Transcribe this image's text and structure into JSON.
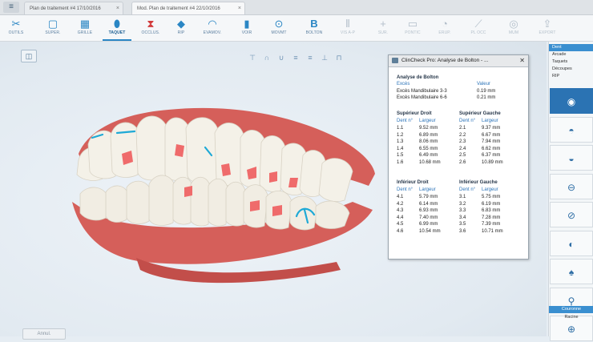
{
  "tabs": [
    {
      "label": "Plan de traitement #4 17/10/2016"
    },
    {
      "label": "Mod. Plan de traitement #4 22/10/2016"
    }
  ],
  "toolbar": [
    {
      "label": "OUTILS",
      "icon": "tools-icon",
      "glyph": "✂",
      "enabled": true
    },
    {
      "label": "SUPER.",
      "icon": "superimpose-icon",
      "glyph": "▢",
      "enabled": true
    },
    {
      "label": "GRILLE",
      "icon": "grid-icon",
      "glyph": "▦",
      "enabled": true
    },
    {
      "label": "TAQUET",
      "icon": "attachment-icon",
      "glyph": "⬮",
      "enabled": true,
      "active": true
    },
    {
      "label": "OCCLUS.",
      "icon": "occlusion-icon",
      "glyph": "⧗",
      "enabled": true
    },
    {
      "label": "RIP",
      "icon": "ipr-icon",
      "glyph": "◆",
      "enabled": true
    },
    {
      "label": "EVAMOV.",
      "icon": "evaluation-icon",
      "glyph": "◠",
      "enabled": true
    },
    {
      "label": "VOIR",
      "icon": "view-icon",
      "glyph": "▮",
      "enabled": true
    },
    {
      "label": "MOVMT",
      "icon": "movement-icon",
      "glyph": "⊙",
      "enabled": true
    },
    {
      "label": "BOLTON",
      "icon": "bolton-icon",
      "glyph": "B",
      "enabled": true
    },
    {
      "label": "VIS A-P",
      "icon": "ap-view-icon",
      "glyph": "⫴",
      "enabled": false
    },
    {
      "label": "SUR.",
      "icon": "add-icon",
      "glyph": "+",
      "enabled": false
    },
    {
      "label": "PONTIC",
      "icon": "pontic-icon",
      "glyph": "▭",
      "enabled": false
    },
    {
      "label": "ERUP.",
      "icon": "eruption-icon",
      "glyph": "◔",
      "enabled": false
    },
    {
      "label": "PL OCC",
      "icon": "occlusal-plane-icon",
      "glyph": "⟋",
      "enabled": false
    },
    {
      "label": "MUM",
      "icon": "mum-icon",
      "glyph": "◎",
      "enabled": false
    },
    {
      "label": "EXPORT",
      "icon": "export-icon",
      "glyph": "⇪",
      "enabled": false
    }
  ],
  "bolton": {
    "title": "ClinCheck Pro: Analyse de Bolton - ...",
    "heading": "Analyse de Bolton",
    "col_exces": "Excès",
    "col_valeur": "Valeur",
    "rows": [
      {
        "label": "Excès Mandibulaire 3-3",
        "value": "0.19 mm"
      },
      {
        "label": "Excès Mandibulaire 6-6",
        "value": "0.21 mm"
      }
    ],
    "upper_right": {
      "title": "Supérieur Droit",
      "col_dent": "Dent n°",
      "col_largeur": "Largeur",
      "rows": [
        [
          "1.1",
          "9.52 mm"
        ],
        [
          "1.2",
          "6.89 mm"
        ],
        [
          "1.3",
          "8.06 mm"
        ],
        [
          "1.4",
          "6.55 mm"
        ],
        [
          "1.5",
          "6.49 mm"
        ],
        [
          "1.6",
          "10.68 mm"
        ]
      ]
    },
    "upper_left": {
      "title": "Supérieur Gauche",
      "col_dent": "Dent n°",
      "col_largeur": "Largeur",
      "rows": [
        [
          "2.1",
          "9.37 mm"
        ],
        [
          "2.2",
          "6.67 mm"
        ],
        [
          "2.3",
          "7.94 mm"
        ],
        [
          "2.4",
          "6.62 mm"
        ],
        [
          "2.5",
          "6.37 mm"
        ],
        [
          "2.6",
          "10.89 mm"
        ]
      ]
    },
    "lower_right": {
      "title": "Inférieur Droit",
      "col_dent": "Dent n°",
      "col_largeur": "Largeur",
      "rows": [
        [
          "4.1",
          "5.79 mm"
        ],
        [
          "4.2",
          "6.14 mm"
        ],
        [
          "4.3",
          "6.93 mm"
        ],
        [
          "4.4",
          "7.40 mm"
        ],
        [
          "4.5",
          "6.99 mm"
        ],
        [
          "4.6",
          "10.54 mm"
        ]
      ]
    },
    "lower_left": {
      "title": "Inférieur Gauche",
      "col_dent": "Dent n°",
      "col_largeur": "Largeur",
      "rows": [
        [
          "3.1",
          "5.75 mm"
        ],
        [
          "3.2",
          "6.19 mm"
        ],
        [
          "3.3",
          "6.83 mm"
        ],
        [
          "3.4",
          "7.28 mm"
        ],
        [
          "3.5",
          "7.39 mm"
        ],
        [
          "3.6",
          "10.71 mm"
        ]
      ]
    }
  },
  "right_sidebar": {
    "items": [
      "Dent",
      "Arcade",
      "Taquets",
      "Découpes",
      "RIP"
    ],
    "bottom_items": [
      "Couronne",
      "Racine"
    ]
  },
  "bottom_button": "Annul.",
  "colors": {
    "accent": "#2a86c4",
    "gum": "#d9645f",
    "tooth": "#f4f1e8",
    "attachment": "#ef6b6b",
    "marker": "#1ea9d6"
  }
}
